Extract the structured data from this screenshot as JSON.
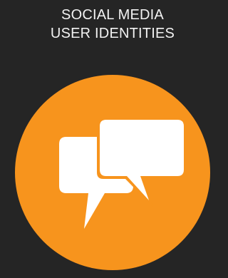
{
  "header": {
    "title_lines": [
      "SOCIAL MEDIA",
      "USER IDENTITIES"
    ]
  },
  "badge": {
    "icon": "chat-bubbles-icon",
    "color": "#F7941D",
    "icon_color": "#FFFFFF"
  },
  "colors": {
    "background": "#252525",
    "text": "#F2F2F2"
  }
}
